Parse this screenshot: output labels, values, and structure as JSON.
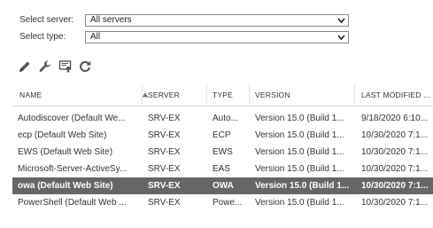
{
  "filters": {
    "server": {
      "label": "Select server:",
      "value": "All servers"
    },
    "type": {
      "label": "Select type:",
      "value": "All"
    }
  },
  "toolbar": {
    "icons": [
      "pencil-icon",
      "wrench-icon",
      "certificate-icon",
      "refresh-icon"
    ]
  },
  "table": {
    "columns": [
      "NAME",
      "SERVER",
      "TYPE",
      "VERSION",
      "LAST MODIFIED ..."
    ],
    "sort": {
      "column": "NAME",
      "direction": "ascending"
    },
    "rows": [
      {
        "name": "Autodiscover (Default We...",
        "server": "SRV-EX",
        "type": "Auto...",
        "version": "Version 15.0 (Build 1...",
        "modified": "9/18/2020 6:10...",
        "selected": false
      },
      {
        "name": "ecp (Default Web Site)",
        "server": "SRV-EX",
        "type": "ECP",
        "version": "Version 15.0 (Build 1...",
        "modified": "10/30/2020 7:1...",
        "selected": false
      },
      {
        "name": "EWS (Default Web Site)",
        "server": "SRV-EX",
        "type": "EWS",
        "version": "Version 15.0 (Build 1...",
        "modified": "10/30/2020 7:1...",
        "selected": false
      },
      {
        "name": "Microsoft-Server-ActiveSy...",
        "server": "SRV-EX",
        "type": "EAS",
        "version": "Version 15.0 (Build 1...",
        "modified": "10/30/2020 7:1...",
        "selected": false
      },
      {
        "name": "owa (Default Web Site)",
        "server": "SRV-EX",
        "type": "OWA",
        "version": "Version 15.0 (Build 1...",
        "modified": "10/30/2020 7:1...",
        "selected": true
      },
      {
        "name": "PowerShell (Default Web ...",
        "server": "SRV-EX",
        "type": "Powe...",
        "version": "Version 15.0 (Build 1...",
        "modified": "10/30/2020 7:1...",
        "selected": false
      }
    ]
  },
  "colors": {
    "selected_row": "#666666",
    "icon": "#555555",
    "header_rule": "#d6d6d6"
  }
}
